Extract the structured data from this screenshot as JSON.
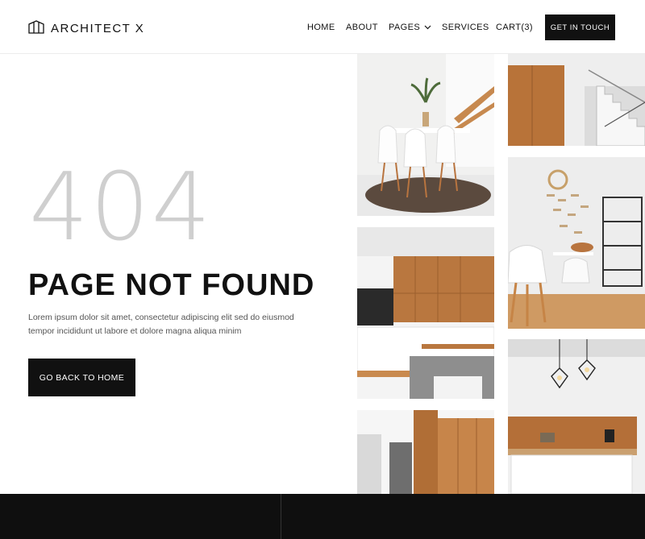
{
  "header": {
    "brand": "ARCHITECT X",
    "nav": [
      {
        "label": "HOME"
      },
      {
        "label": "ABOUT"
      },
      {
        "label": "PAGES"
      },
      {
        "label": "SERVICES"
      },
      {
        "label": "CART(3)"
      }
    ],
    "cta_label": "GET IN TOUCH"
  },
  "main": {
    "code": "404",
    "title": "PAGE NOT FOUND",
    "description": "Lorem ipsum dolor sit amet, consectetur adipiscing elit sed do eiusmod tempor incididunt ut labore et dolore magna aliqua minim",
    "back_label": "GO BACK TO HOME"
  },
  "gallery": {
    "images": [
      {
        "name": "dining-room-photo",
        "icon": "dining-room-image"
      },
      {
        "name": "staircase-photo",
        "icon": "staircase-image"
      },
      {
        "name": "kitchen-cabinets-photo",
        "icon": "kitchen-image"
      },
      {
        "name": "chair-wall-decor-photo",
        "icon": "chair-image"
      },
      {
        "name": "hallway-wood-photo",
        "icon": "hallway-image"
      },
      {
        "name": "pendant-lamp-kitchen-photo",
        "icon": "pendant-lamp-image"
      }
    ]
  },
  "colors": {
    "accent": "#111111",
    "muted_code": "#cfcfcf",
    "footer": "#0f0f0f",
    "wood": "#b8743f"
  }
}
